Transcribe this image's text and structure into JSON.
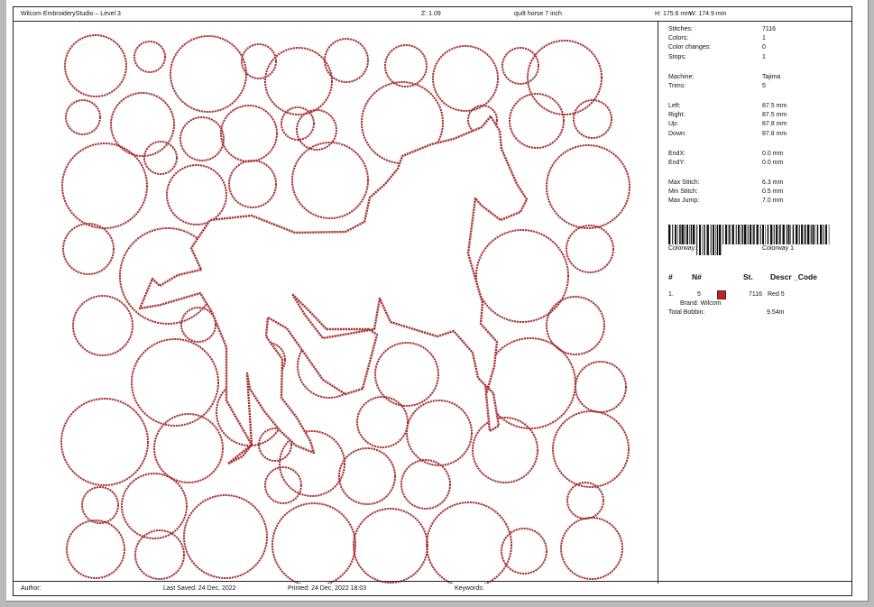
{
  "header": {
    "app_title": "Wilcom EmbroideryStudio – Level 3",
    "zoom": "Z: 1.09",
    "design_name": "quilt horse 7 inch",
    "height": "H: 175.6 mm",
    "width": "W: 174.9 mm"
  },
  "stats": {
    "stitches": {
      "label": "Stitches:",
      "value": "7116"
    },
    "colors": {
      "label": "Colors:",
      "value": "1"
    },
    "color_changes": {
      "label": "Color changes:",
      "value": "0"
    },
    "stops": {
      "label": "Stops:",
      "value": "1"
    },
    "machine": {
      "label": "Machine:",
      "value": "Tajima"
    },
    "trims": {
      "label": "Trims:",
      "value": "5"
    },
    "left": {
      "label": "Left:",
      "value": "87.5 mm"
    },
    "right": {
      "label": "Right:",
      "value": "87.5 mm"
    },
    "up": {
      "label": "Up:",
      "value": "87.8 mm"
    },
    "down": {
      "label": "Down:",
      "value": "87.8 mm"
    },
    "endx": {
      "label": "EndX:",
      "value": "0.0 mm"
    },
    "endy": {
      "label": "EndY:",
      "value": "0.0 mm"
    },
    "max_stitch": {
      "label": "Max Stitch:",
      "value": "6.3 mm"
    },
    "min_stitch": {
      "label": "Min Stitch:",
      "value": "0.5 mm"
    },
    "max_jump": {
      "label": "Max Jump:",
      "value": "7.0 mm"
    }
  },
  "colorway": {
    "label": "Colorway:",
    "value": "Colorway 1"
  },
  "thread_table": {
    "headers": {
      "num": "#",
      "n": "N#",
      "st": "St.",
      "descr": "Descr _Code"
    },
    "row": {
      "index": "1.",
      "n": "5",
      "stitches": "7116",
      "descr": "Red 5",
      "swatch_color": "#c8201c"
    },
    "brand": "Brand: Wilcom",
    "bobbin_label": "Total Bobbin:",
    "bobbin_value": "9.54m"
  },
  "footer": {
    "author": "Author:",
    "last_saved": "Last Saved: 24 Dec, 2022",
    "printed": "Printed: 24 Dec, 2022 18:03",
    "keywords": "Keywords:"
  },
  "colors": {
    "thread": "#a83232",
    "background": "#b9b9b9"
  }
}
